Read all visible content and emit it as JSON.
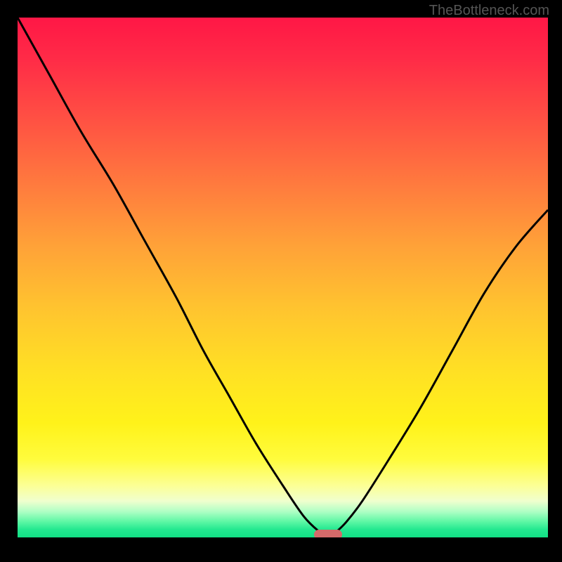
{
  "watermark": "TheBottleneck.com",
  "colors": {
    "page_bg": "#000000",
    "curve": "#000000",
    "marker": "#d46a6a",
    "gradient_top": "#ff1746",
    "gradient_bottom": "#12e085"
  },
  "chart_data": {
    "type": "line",
    "title": "",
    "xlabel": "",
    "ylabel": "",
    "xlim": [
      0,
      100
    ],
    "ylim": [
      0,
      100
    ],
    "grid": false,
    "legend": null,
    "series": [
      {
        "name": "bottleneck-curve",
        "x": [
          0,
          6,
          12,
          18,
          24,
          30,
          35,
          40,
          45,
          50,
          54,
          57,
          58.5,
          60,
          62,
          65,
          70,
          76,
          82,
          88,
          94,
          100
        ],
        "values": [
          100,
          89,
          78,
          68,
          57,
          46,
          36,
          27,
          18,
          10,
          4,
          1,
          0,
          1,
          3,
          7,
          15,
          25,
          36,
          47,
          56,
          63
        ]
      }
    ],
    "minimum_point": {
      "x": 58.5,
      "y": 0
    },
    "annotations": []
  }
}
